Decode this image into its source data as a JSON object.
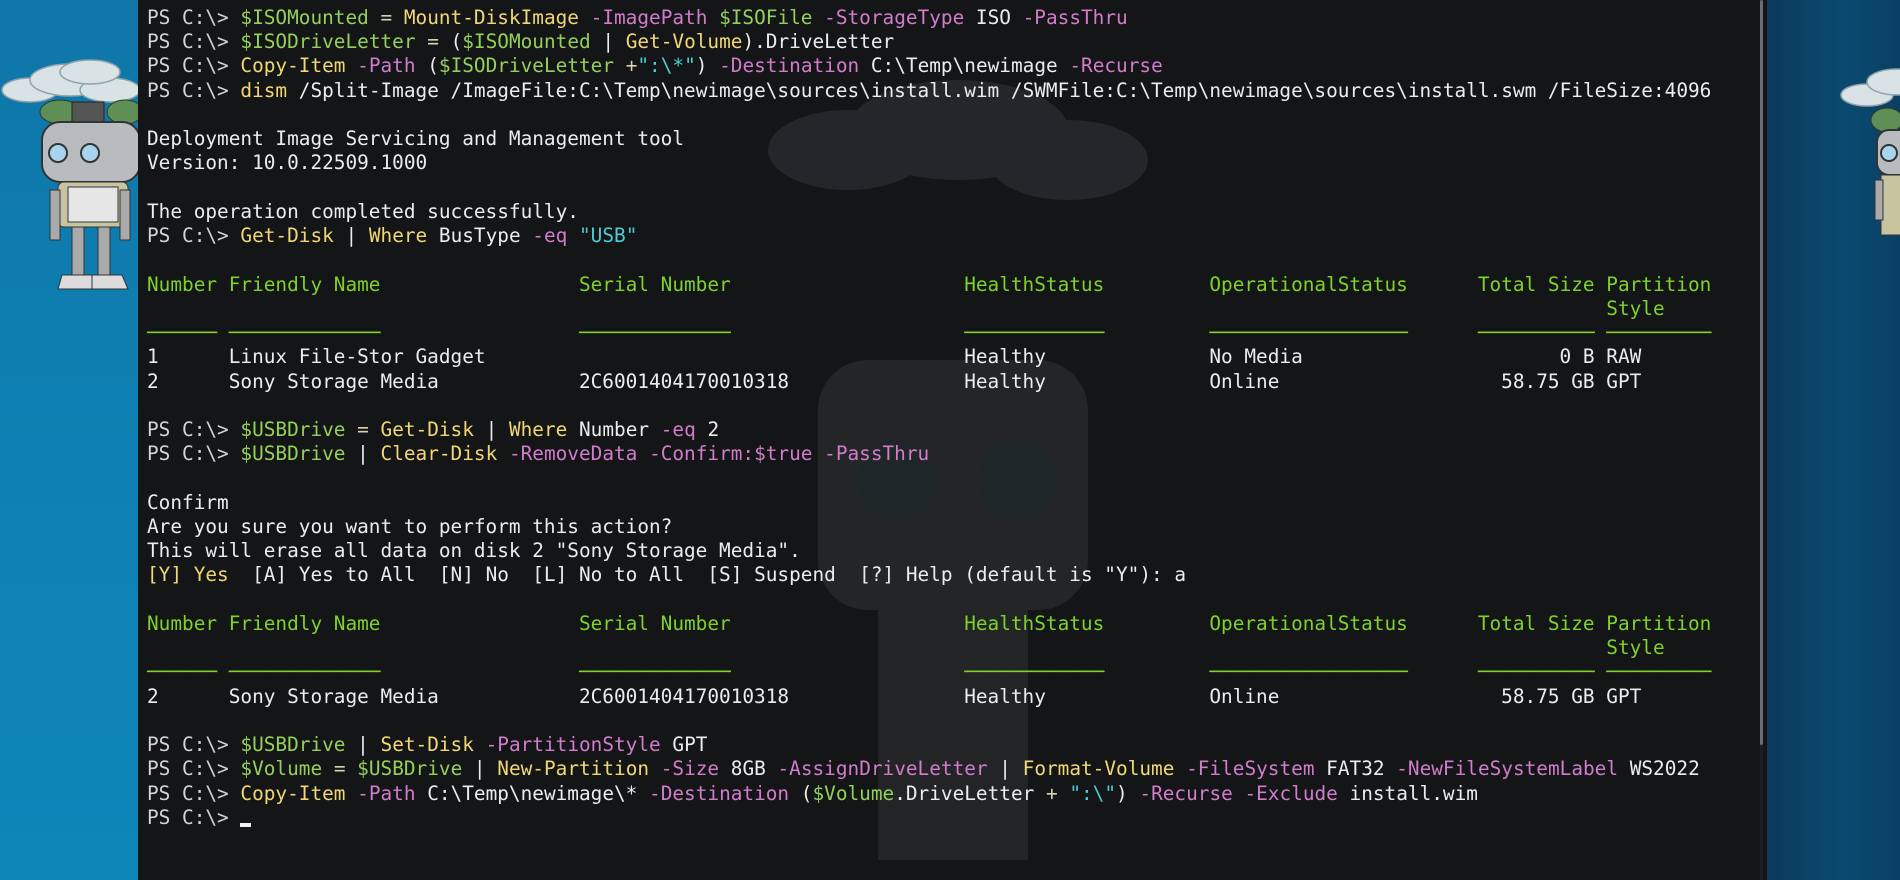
{
  "colors": {
    "terminal_bg": "#131517",
    "variable": "#95d05a",
    "cmdlet": "#f1d874",
    "parameter": "#d27ccb",
    "string": "#4ccbd6",
    "table_header": "#7fd12c",
    "desktop_left": "#0e82b5",
    "desktop_right": "#0b4a70"
  },
  "tables": [
    {
      "headers": [
        [
          "Number"
        ],
        [
          "Friendly Name"
        ],
        [
          "Serial Number"
        ],
        [
          "HealthStatus"
        ],
        [
          "OperationalStatus"
        ],
        [
          "Total Size"
        ],
        [
          "Partition",
          "Style"
        ]
      ],
      "underlines": [
        "──────",
        "─────────────",
        "─────────────",
        "────────────",
        "─────────────────",
        "──────────",
        "─────────"
      ],
      "rows": [
        [
          "1",
          "Linux File-Stor Gadget",
          "",
          "Healthy",
          "No Media",
          "0 B",
          "RAW"
        ],
        [
          "2",
          "Sony Storage Media",
          "2C6001404170010318",
          "Healthy",
          "Online",
          "58.75 GB",
          "GPT"
        ]
      ]
    },
    {
      "headers": [
        [
          "Number"
        ],
        [
          "Friendly Name"
        ],
        [
          "Serial Number"
        ],
        [
          "HealthStatus"
        ],
        [
          "OperationalStatus"
        ],
        [
          "Total Size"
        ],
        [
          "Partition",
          "Style"
        ]
      ],
      "underlines": [
        "──────",
        "─────────────",
        "─────────────",
        "────────────",
        "─────────────────",
        "──────────",
        "─────────"
      ],
      "rows": [
        [
          "2",
          "Sony Storage Media",
          "2C6001404170010318",
          "Healthy",
          "Online",
          "58.75 GB",
          "GPT"
        ]
      ]
    }
  ],
  "blocks": [
    {
      "segs": [
        [
          "p",
          "PS C:\\> "
        ],
        [
          "v",
          "$ISOMounted"
        ],
        [
          "o",
          " = "
        ],
        [
          "c",
          "Mount-DiskImage"
        ],
        [
          "a",
          " -ImagePath"
        ],
        [
          "v",
          " $ISOFile"
        ],
        [
          "a",
          " -StorageType"
        ],
        [
          "t",
          " ISO"
        ],
        [
          "a",
          " -PassThru"
        ]
      ]
    },
    {
      "segs": [
        [
          "p",
          "PS C:\\> "
        ],
        [
          "v",
          "$ISODriveLetter"
        ],
        [
          "o",
          " = "
        ],
        [
          "t",
          "("
        ],
        [
          "v",
          "$ISOMounted"
        ],
        [
          "t",
          " | "
        ],
        [
          "c",
          "Get-Volume"
        ],
        [
          "t",
          ").DriveLetter"
        ]
      ]
    },
    {
      "segs": [
        [
          "p",
          "PS C:\\> "
        ],
        [
          "c",
          "Copy-Item"
        ],
        [
          "a",
          " -Path"
        ],
        [
          "t",
          " ("
        ],
        [
          "v",
          "$ISODriveLetter"
        ],
        [
          "o",
          " +"
        ],
        [
          "s",
          "\":\\*\""
        ],
        [
          "t",
          ")"
        ],
        [
          "a",
          " -Destination"
        ],
        [
          "t",
          " C:\\Temp\\newimage"
        ],
        [
          "a",
          " -Recurse"
        ]
      ]
    },
    {
      "segs": [
        [
          "p",
          "PS C:\\> "
        ],
        [
          "c",
          "dism"
        ],
        [
          "t",
          " /Split-Image /ImageFile:C:\\Temp\\newimage\\sources\\install.wim /SWMFile:C:\\Temp\\newimage\\sources\\install.swm /FileSize:4096"
        ]
      ]
    },
    {
      "segs": []
    },
    {
      "segs": [
        [
          "t",
          "Deployment Image Servicing and Management tool"
        ]
      ]
    },
    {
      "segs": [
        [
          "t",
          "Version: 10.0.22509.1000"
        ]
      ]
    },
    {
      "segs": []
    },
    {
      "segs": [
        [
          "t",
          "The operation completed successfully."
        ]
      ]
    },
    {
      "segs": [
        [
          "p",
          "PS C:\\> "
        ],
        [
          "c",
          "Get-Disk"
        ],
        [
          "t",
          " | "
        ],
        [
          "c",
          "Where"
        ],
        [
          "t",
          " BusType"
        ],
        [
          "a",
          " -eq"
        ],
        [
          "s",
          " \"USB\""
        ]
      ]
    },
    {
      "segs": []
    },
    {
      "table": 0
    },
    {
      "segs": []
    },
    {
      "segs": [
        [
          "p",
          "PS C:\\> "
        ],
        [
          "v",
          "$USBDrive"
        ],
        [
          "o",
          " = "
        ],
        [
          "c",
          "Get-Disk"
        ],
        [
          "t",
          " | "
        ],
        [
          "c",
          "Where"
        ],
        [
          "t",
          " Number"
        ],
        [
          "a",
          " -eq"
        ],
        [
          "t",
          " 2"
        ]
      ]
    },
    {
      "segs": [
        [
          "p",
          "PS C:\\> "
        ],
        [
          "v",
          "$USBDrive"
        ],
        [
          "t",
          " | "
        ],
        [
          "c",
          "Clear-Disk"
        ],
        [
          "a",
          " -RemoveData -Confirm:$true -PassThru"
        ]
      ]
    },
    {
      "segs": []
    },
    {
      "segs": [
        [
          "t",
          "Confirm"
        ]
      ]
    },
    {
      "segs": [
        [
          "t",
          "Are you sure you want to perform this action?"
        ]
      ]
    },
    {
      "segs": [
        [
          "t",
          "This will erase all data on disk 2 \"Sony Storage Media\"."
        ]
      ]
    },
    {
      "segs": [
        [
          "y",
          "[Y] Yes"
        ],
        [
          "t",
          "  [A] Yes to All  [N] No  [L] No to All  [S] Suspend  [?] Help (default is \"Y\"): a"
        ]
      ]
    },
    {
      "segs": []
    },
    {
      "table": 1
    },
    {
      "segs": []
    },
    {
      "segs": [
        [
          "p",
          "PS C:\\> "
        ],
        [
          "v",
          "$USBDrive"
        ],
        [
          "t",
          " | "
        ],
        [
          "c",
          "Set-Disk"
        ],
        [
          "a",
          " -PartitionStyle"
        ],
        [
          "t",
          " GPT"
        ]
      ]
    },
    {
      "segs": [
        [
          "p",
          "PS C:\\> "
        ],
        [
          "v",
          "$Volume"
        ],
        [
          "o",
          " = "
        ],
        [
          "v",
          "$USBDrive"
        ],
        [
          "t",
          " | "
        ],
        [
          "c",
          "New-Partition"
        ],
        [
          "a",
          " -Size"
        ],
        [
          "t",
          " 8GB"
        ],
        [
          "a",
          " -AssignDriveLetter"
        ],
        [
          "t",
          " | "
        ],
        [
          "c",
          "Format-Volume"
        ],
        [
          "a",
          " -FileSystem"
        ],
        [
          "t",
          " FAT32"
        ],
        [
          "a",
          " -NewFileSystemLabel"
        ],
        [
          "t",
          " WS2022"
        ]
      ]
    },
    {
      "segs": [
        [
          "p",
          "PS C:\\> "
        ],
        [
          "c",
          "Copy-Item"
        ],
        [
          "a",
          " -Path"
        ],
        [
          "t",
          " C:\\Temp\\newimage\\*"
        ],
        [
          "a",
          " -Destination"
        ],
        [
          "t",
          " ("
        ],
        [
          "v",
          "$Volume"
        ],
        [
          "t",
          ".DriveLetter"
        ],
        [
          "o",
          " + "
        ],
        [
          "s",
          "\":\\\""
        ],
        [
          "t",
          ")"
        ],
        [
          "a",
          " -Recurse -Exclude"
        ],
        [
          "t",
          " install.wim"
        ]
      ]
    },
    {
      "segs": [
        [
          "p",
          "PS C:\\> "
        ]
      ],
      "cursor": true
    }
  ]
}
